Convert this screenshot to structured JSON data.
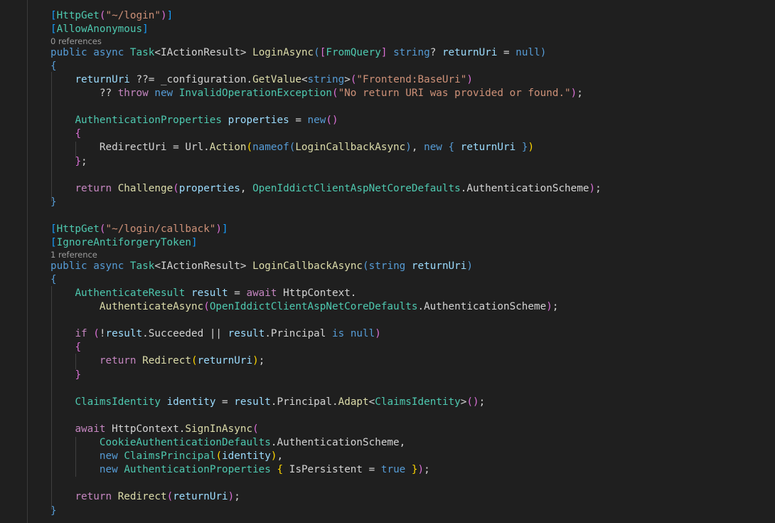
{
  "editor": {
    "theme_colors": {
      "background": "#1f1f1f",
      "keyword": "#569cd6",
      "control": "#c586c0",
      "type": "#4ec9b0",
      "function": "#dcdcaa",
      "variable": "#9cdcfe",
      "string": "#ce9178"
    },
    "lines": [
      {
        "kind": "code",
        "tokens": [
          [
            "b0",
            "["
          ],
          [
            "t-attr",
            "HttpGet"
          ],
          [
            "b2",
            "("
          ],
          [
            "t-str",
            "\"~/login\""
          ],
          [
            "b2",
            ")"
          ],
          [
            "b0",
            "]"
          ]
        ]
      },
      {
        "kind": "code",
        "tokens": [
          [
            "b0",
            "["
          ],
          [
            "t-attr",
            "AllowAnonymous"
          ],
          [
            "b0",
            "]"
          ]
        ]
      },
      {
        "kind": "lens",
        "text": "0 references"
      },
      {
        "kind": "code",
        "tokens": [
          [
            "t-kw",
            "public"
          ],
          [
            "t-pl",
            " "
          ],
          [
            "t-kw",
            "async"
          ],
          [
            "t-pl",
            " "
          ],
          [
            "t-type",
            "Task"
          ],
          [
            "t-pl",
            "<"
          ],
          [
            "t-pl",
            "IActionResult"
          ],
          [
            "t-pl",
            "> "
          ],
          [
            "t-fn",
            "LoginAsync"
          ],
          [
            "b1",
            "("
          ],
          [
            "b2",
            "["
          ],
          [
            "t-attr",
            "FromQuery"
          ],
          [
            "b2",
            "]"
          ],
          [
            "t-pl",
            " "
          ],
          [
            "t-kw",
            "string"
          ],
          [
            "t-pl",
            "? "
          ],
          [
            "t-var",
            "returnUri"
          ],
          [
            "t-pl",
            " = "
          ],
          [
            "t-kw",
            "null"
          ],
          [
            "b1",
            ")"
          ]
        ]
      },
      {
        "kind": "code",
        "tokens": [
          [
            "b1",
            "{"
          ]
        ]
      },
      {
        "kind": "code",
        "tokens": [
          [
            "t-pl",
            "    "
          ],
          [
            "t-var",
            "returnUri"
          ],
          [
            "t-pl",
            " ??= _configuration."
          ],
          [
            "t-fn",
            "GetValue"
          ],
          [
            "t-pl",
            "<"
          ],
          [
            "t-kw",
            "string"
          ],
          [
            "t-pl",
            ">"
          ],
          [
            "b2",
            "("
          ],
          [
            "t-str",
            "\"Frontend:BaseUri\""
          ],
          [
            "b2",
            ")"
          ]
        ]
      },
      {
        "kind": "code",
        "tokens": [
          [
            "t-pl",
            "        ?? "
          ],
          [
            "t-ctl",
            "throw"
          ],
          [
            "t-pl",
            " "
          ],
          [
            "t-kw",
            "new"
          ],
          [
            "t-pl",
            " "
          ],
          [
            "t-type",
            "InvalidOperationException"
          ],
          [
            "b2",
            "("
          ],
          [
            "t-str",
            "\"No return URI was provided or found.\""
          ],
          [
            "b2",
            ")"
          ],
          [
            "t-pl",
            ";"
          ]
        ]
      },
      {
        "kind": "code",
        "tokens": [
          [
            "t-pl",
            ""
          ]
        ]
      },
      {
        "kind": "code",
        "tokens": [
          [
            "t-pl",
            "    "
          ],
          [
            "t-type",
            "AuthenticationProperties"
          ],
          [
            "t-pl",
            " "
          ],
          [
            "t-var",
            "properties"
          ],
          [
            "t-pl",
            " = "
          ],
          [
            "t-kw",
            "new"
          ],
          [
            "b2",
            "()"
          ]
        ]
      },
      {
        "kind": "code",
        "tokens": [
          [
            "t-pl",
            "    "
          ],
          [
            "b2",
            "{"
          ]
        ]
      },
      {
        "kind": "code",
        "tokens": [
          [
            "t-pl",
            "        RedirectUri = Url."
          ],
          [
            "t-fn",
            "Action"
          ],
          [
            "b3",
            "("
          ],
          [
            "t-kw",
            "nameof"
          ],
          [
            "b1",
            "("
          ],
          [
            "t-fn",
            "LoginCallbackAsync"
          ],
          [
            "b1",
            ")"
          ],
          [
            "t-pl",
            ", "
          ],
          [
            "t-kw",
            "new"
          ],
          [
            "t-pl",
            " "
          ],
          [
            "b1",
            "{"
          ],
          [
            "t-pl",
            " "
          ],
          [
            "t-var",
            "returnUri"
          ],
          [
            "t-pl",
            " "
          ],
          [
            "b1",
            "}"
          ],
          [
            "b3",
            ")"
          ]
        ]
      },
      {
        "kind": "code",
        "tokens": [
          [
            "t-pl",
            "    "
          ],
          [
            "b2",
            "}"
          ],
          [
            "t-pl",
            ";"
          ]
        ]
      },
      {
        "kind": "code",
        "tokens": [
          [
            "t-pl",
            ""
          ]
        ]
      },
      {
        "kind": "code",
        "tokens": [
          [
            "t-pl",
            "    "
          ],
          [
            "t-ctl",
            "return"
          ],
          [
            "t-pl",
            " "
          ],
          [
            "t-fn",
            "Challenge"
          ],
          [
            "b2",
            "("
          ],
          [
            "t-var",
            "properties"
          ],
          [
            "t-pl",
            ", "
          ],
          [
            "t-type",
            "OpenIddictClientAspNetCoreDefaults"
          ],
          [
            "t-pl",
            ".AuthenticationScheme"
          ],
          [
            "b2",
            ")"
          ],
          [
            "t-pl",
            ";"
          ]
        ]
      },
      {
        "kind": "code",
        "tokens": [
          [
            "b1",
            "}"
          ]
        ]
      },
      {
        "kind": "code",
        "tokens": [
          [
            "t-pl",
            ""
          ]
        ]
      },
      {
        "kind": "code",
        "tokens": [
          [
            "b0",
            "["
          ],
          [
            "t-attr",
            "HttpGet"
          ],
          [
            "b2",
            "("
          ],
          [
            "t-str",
            "\"~/login/callback\""
          ],
          [
            "b2",
            ")"
          ],
          [
            "b0",
            "]"
          ]
        ]
      },
      {
        "kind": "code",
        "tokens": [
          [
            "b0",
            "["
          ],
          [
            "t-attr",
            "IgnoreAntiforgeryToken"
          ],
          [
            "b0",
            "]"
          ]
        ]
      },
      {
        "kind": "lens",
        "text": "1 reference"
      },
      {
        "kind": "code",
        "tokens": [
          [
            "t-kw",
            "public"
          ],
          [
            "t-pl",
            " "
          ],
          [
            "t-kw",
            "async"
          ],
          [
            "t-pl",
            " "
          ],
          [
            "t-type",
            "Task"
          ],
          [
            "t-pl",
            "<"
          ],
          [
            "t-pl",
            "IActionResult"
          ],
          [
            "t-pl",
            "> "
          ],
          [
            "t-fn",
            "LoginCallbackAsync"
          ],
          [
            "b1",
            "("
          ],
          [
            "t-kw",
            "string"
          ],
          [
            "t-pl",
            " "
          ],
          [
            "t-var",
            "returnUri"
          ],
          [
            "b1",
            ")"
          ]
        ]
      },
      {
        "kind": "code",
        "tokens": [
          [
            "b1",
            "{"
          ]
        ]
      },
      {
        "kind": "code",
        "tokens": [
          [
            "t-pl",
            "    "
          ],
          [
            "t-type",
            "AuthenticateResult"
          ],
          [
            "t-pl",
            " "
          ],
          [
            "t-var",
            "result"
          ],
          [
            "t-pl",
            " = "
          ],
          [
            "t-ctl",
            "await"
          ],
          [
            "t-pl",
            " HttpContext."
          ]
        ]
      },
      {
        "kind": "code",
        "tokens": [
          [
            "t-pl",
            "        "
          ],
          [
            "t-fn",
            "AuthenticateAsync"
          ],
          [
            "b2",
            "("
          ],
          [
            "t-type",
            "OpenIddictClientAspNetCoreDefaults"
          ],
          [
            "t-pl",
            ".AuthenticationScheme"
          ],
          [
            "b2",
            ")"
          ],
          [
            "t-pl",
            ";"
          ]
        ]
      },
      {
        "kind": "code",
        "tokens": [
          [
            "t-pl",
            ""
          ]
        ]
      },
      {
        "kind": "code",
        "tokens": [
          [
            "t-pl",
            "    "
          ],
          [
            "t-ctl",
            "if"
          ],
          [
            "t-pl",
            " "
          ],
          [
            "b2",
            "("
          ],
          [
            "t-pl",
            "!"
          ],
          [
            "t-var",
            "result"
          ],
          [
            "t-pl",
            ".Succeeded || "
          ],
          [
            "t-var",
            "result"
          ],
          [
            "t-pl",
            ".Principal "
          ],
          [
            "t-kw",
            "is"
          ],
          [
            "t-pl",
            " "
          ],
          [
            "t-kw",
            "null"
          ],
          [
            "b2",
            ")"
          ]
        ]
      },
      {
        "kind": "code",
        "tokens": [
          [
            "t-pl",
            "    "
          ],
          [
            "b2",
            "{"
          ]
        ]
      },
      {
        "kind": "code",
        "tokens": [
          [
            "t-pl",
            "        "
          ],
          [
            "t-ctl",
            "return"
          ],
          [
            "t-pl",
            " "
          ],
          [
            "t-fn",
            "Redirect"
          ],
          [
            "b3",
            "("
          ],
          [
            "t-var",
            "returnUri"
          ],
          [
            "b3",
            ")"
          ],
          [
            "t-pl",
            ";"
          ]
        ]
      },
      {
        "kind": "code",
        "tokens": [
          [
            "t-pl",
            "    "
          ],
          [
            "b2",
            "}"
          ]
        ]
      },
      {
        "kind": "code",
        "tokens": [
          [
            "t-pl",
            ""
          ]
        ]
      },
      {
        "kind": "code",
        "tokens": [
          [
            "t-pl",
            "    "
          ],
          [
            "t-type",
            "ClaimsIdentity"
          ],
          [
            "t-pl",
            " "
          ],
          [
            "t-var",
            "identity"
          ],
          [
            "t-pl",
            " = "
          ],
          [
            "t-var",
            "result"
          ],
          [
            "t-pl",
            ".Principal."
          ],
          [
            "t-fn",
            "Adapt"
          ],
          [
            "t-pl",
            "<"
          ],
          [
            "t-type",
            "ClaimsIdentity"
          ],
          [
            "t-pl",
            ">"
          ],
          [
            "b2",
            "()"
          ],
          [
            "t-pl",
            ";"
          ]
        ]
      },
      {
        "kind": "code",
        "tokens": [
          [
            "t-pl",
            ""
          ]
        ]
      },
      {
        "kind": "code",
        "tokens": [
          [
            "t-pl",
            "    "
          ],
          [
            "t-ctl",
            "await"
          ],
          [
            "t-pl",
            " HttpContext."
          ],
          [
            "t-fn",
            "SignInAsync"
          ],
          [
            "b2",
            "("
          ]
        ]
      },
      {
        "kind": "code",
        "tokens": [
          [
            "t-pl",
            "        "
          ],
          [
            "t-type",
            "CookieAuthenticationDefaults"
          ],
          [
            "t-pl",
            ".AuthenticationScheme,"
          ]
        ]
      },
      {
        "kind": "code",
        "tokens": [
          [
            "t-pl",
            "        "
          ],
          [
            "t-kw",
            "new"
          ],
          [
            "t-pl",
            " "
          ],
          [
            "t-type",
            "ClaimsPrincipal"
          ],
          [
            "b3",
            "("
          ],
          [
            "t-var",
            "identity"
          ],
          [
            "b3",
            ")"
          ],
          [
            "t-pl",
            ","
          ]
        ]
      },
      {
        "kind": "code",
        "tokens": [
          [
            "t-pl",
            "        "
          ],
          [
            "t-kw",
            "new"
          ],
          [
            "t-pl",
            " "
          ],
          [
            "t-type",
            "AuthenticationProperties"
          ],
          [
            "t-pl",
            " "
          ],
          [
            "b3",
            "{"
          ],
          [
            "t-pl",
            " IsPersistent = "
          ],
          [
            "t-kw",
            "true"
          ],
          [
            "t-pl",
            " "
          ],
          [
            "b3",
            "}"
          ],
          [
            "b2",
            ")"
          ],
          [
            "t-pl",
            ";"
          ]
        ]
      },
      {
        "kind": "code",
        "tokens": [
          [
            "t-pl",
            ""
          ]
        ]
      },
      {
        "kind": "code",
        "tokens": [
          [
            "t-pl",
            "    "
          ],
          [
            "t-ctl",
            "return"
          ],
          [
            "t-pl",
            " "
          ],
          [
            "t-fn",
            "Redirect"
          ],
          [
            "b2",
            "("
          ],
          [
            "t-var",
            "returnUri"
          ],
          [
            "b2",
            ")"
          ],
          [
            "t-pl",
            ";"
          ]
        ]
      },
      {
        "kind": "code",
        "tokens": [
          [
            "b1",
            "}"
          ]
        ]
      }
    ]
  }
}
